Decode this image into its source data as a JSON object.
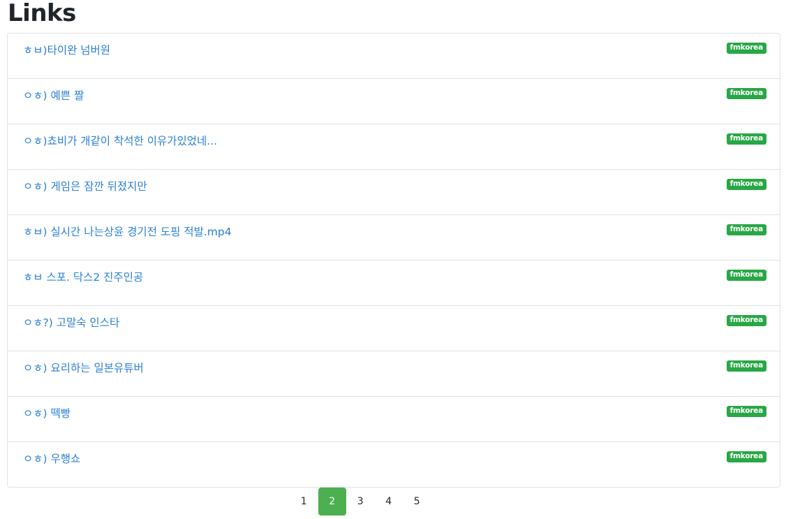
{
  "page": {
    "title": "Links"
  },
  "links": [
    {
      "text": "ㅎㅂ)타이완 넘버원",
      "badge": "fmkorea"
    },
    {
      "text": "ㅇㅎ) 예쁜 짤",
      "badge": "fmkorea"
    },
    {
      "text": "ㅇㅎ)쵸비가 개같이 착석한 이유가있었네...",
      "badge": "fmkorea"
    },
    {
      "text": "ㅇㅎ) 게임은 잠깐 뒤졌지만",
      "badge": "fmkorea"
    },
    {
      "text": "ㅎㅂ) 실시간 나는상윤 경기전 도핑 적발.mp4",
      "badge": "fmkorea"
    },
    {
      "text": "ㅎㅂ 스포. 닥스2 진주인공",
      "badge": "fmkorea"
    },
    {
      "text": "ㅇㅎ?) 고말숙 인스타",
      "badge": "fmkorea"
    },
    {
      "text": "ㅇㅎ) 요리하는 일본유튜버",
      "badge": "fmkorea"
    },
    {
      "text": "ㅇㅎ) 떽빵",
      "badge": "fmkorea"
    },
    {
      "text": "ㅇㅎ) 우행쇼",
      "badge": "fmkorea"
    }
  ],
  "pagination": {
    "pages": [
      "1",
      "2",
      "3",
      "4",
      "5"
    ],
    "active": "2"
  },
  "colors": {
    "link": "#2a7fd4",
    "badge": "#28a745",
    "active_page": "#4caf50"
  }
}
